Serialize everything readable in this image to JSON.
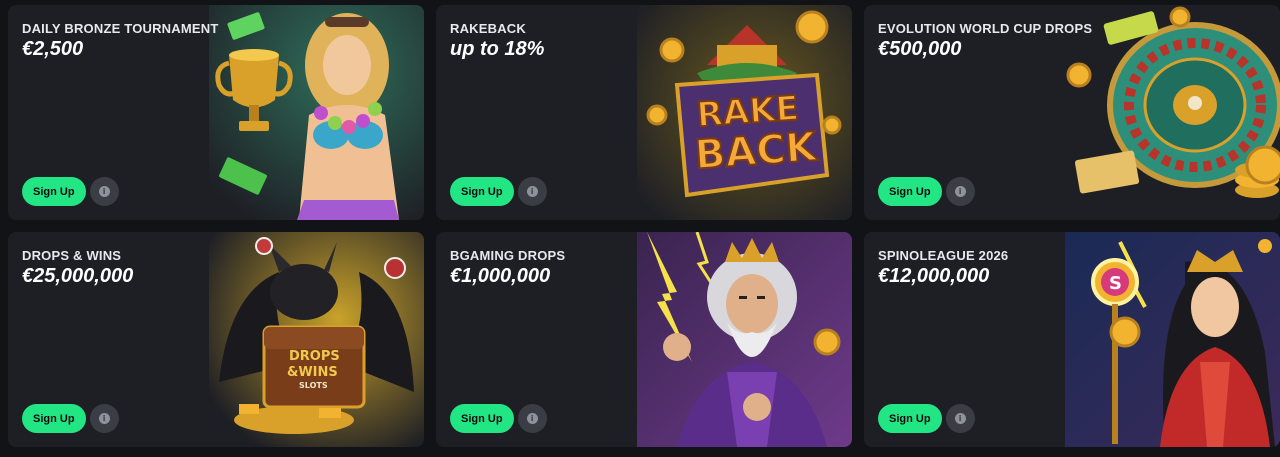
{
  "colors": {
    "page_bg": "#121317",
    "card_bg": "#1e1f25",
    "signup_green": "#22e584",
    "info_bg": "#3b3d45"
  },
  "promotions": [
    {
      "title": "DAILY BRONZE TOURNAMENT",
      "value": "€2,500",
      "signup_label": "Sign Up",
      "info_icon": "i",
      "art": "bronze-tournament-illustration"
    },
    {
      "title": "RAKEBACK",
      "value": "up to 18%",
      "signup_label": "Sign Up",
      "info_icon": "i",
      "art": "rakeback-illustration",
      "art_text": [
        "RAKE",
        "BACK"
      ]
    },
    {
      "title": "EVOLUTION WORLD CUP DROPS",
      "value": "€500,000",
      "signup_label": "Sign Up",
      "info_icon": "i",
      "art": "roulette-wheel-illustration"
    },
    {
      "title": "DROPS & WINS",
      "value": "€25,000,000",
      "signup_label": "Sign Up",
      "info_icon": "i",
      "art": "dragon-chest-illustration",
      "art_text": [
        "DROPS",
        "&WINS",
        "SLOTS"
      ]
    },
    {
      "title": "BGAMING DROPS",
      "value": "€1,000,000",
      "signup_label": "Sign Up",
      "info_icon": "i",
      "art": "zeus-illustration"
    },
    {
      "title": "SPINOLEAGUE 2026",
      "value": "€12,000,000",
      "signup_label": "Sign Up",
      "info_icon": "i",
      "art": "warrior-woman-illustration",
      "art_text": [
        "S"
      ]
    }
  ]
}
